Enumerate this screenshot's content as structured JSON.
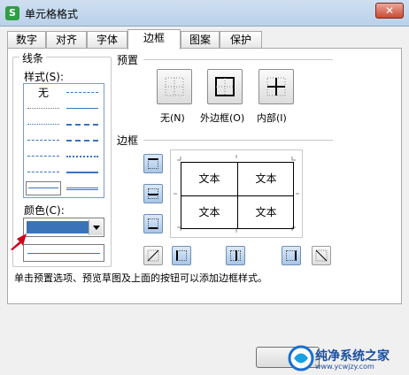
{
  "window": {
    "title": "单元格格式",
    "app_icon": "S"
  },
  "tabs": [
    {
      "label": "数字",
      "active": false
    },
    {
      "label": "对齐",
      "active": false
    },
    {
      "label": "字体",
      "active": false
    },
    {
      "label": "边框",
      "active": true
    },
    {
      "label": "图案",
      "active": false
    },
    {
      "label": "保护",
      "active": false
    }
  ],
  "line_group": {
    "title": "线条",
    "style_label": "样式(S):",
    "none_label": "无",
    "color_label": "颜色(C):",
    "color_value": "#3b73b9"
  },
  "preset": {
    "title": "预置",
    "none_label": "无(N)",
    "outline_label": "外边框(O)",
    "inside_label": "内部(I)"
  },
  "border": {
    "title": "边框",
    "cells": [
      "文本",
      "文本",
      "文本",
      "文本"
    ]
  },
  "hint": "单击预置选项、预览草图及上面的按钮可以添加边框样式。",
  "watermark": {
    "text": "纯净系统之家",
    "sub": "www.ycwjzy.com"
  },
  "colors": {
    "accent": "#3b73b9",
    "arrow": "#d0021b"
  }
}
